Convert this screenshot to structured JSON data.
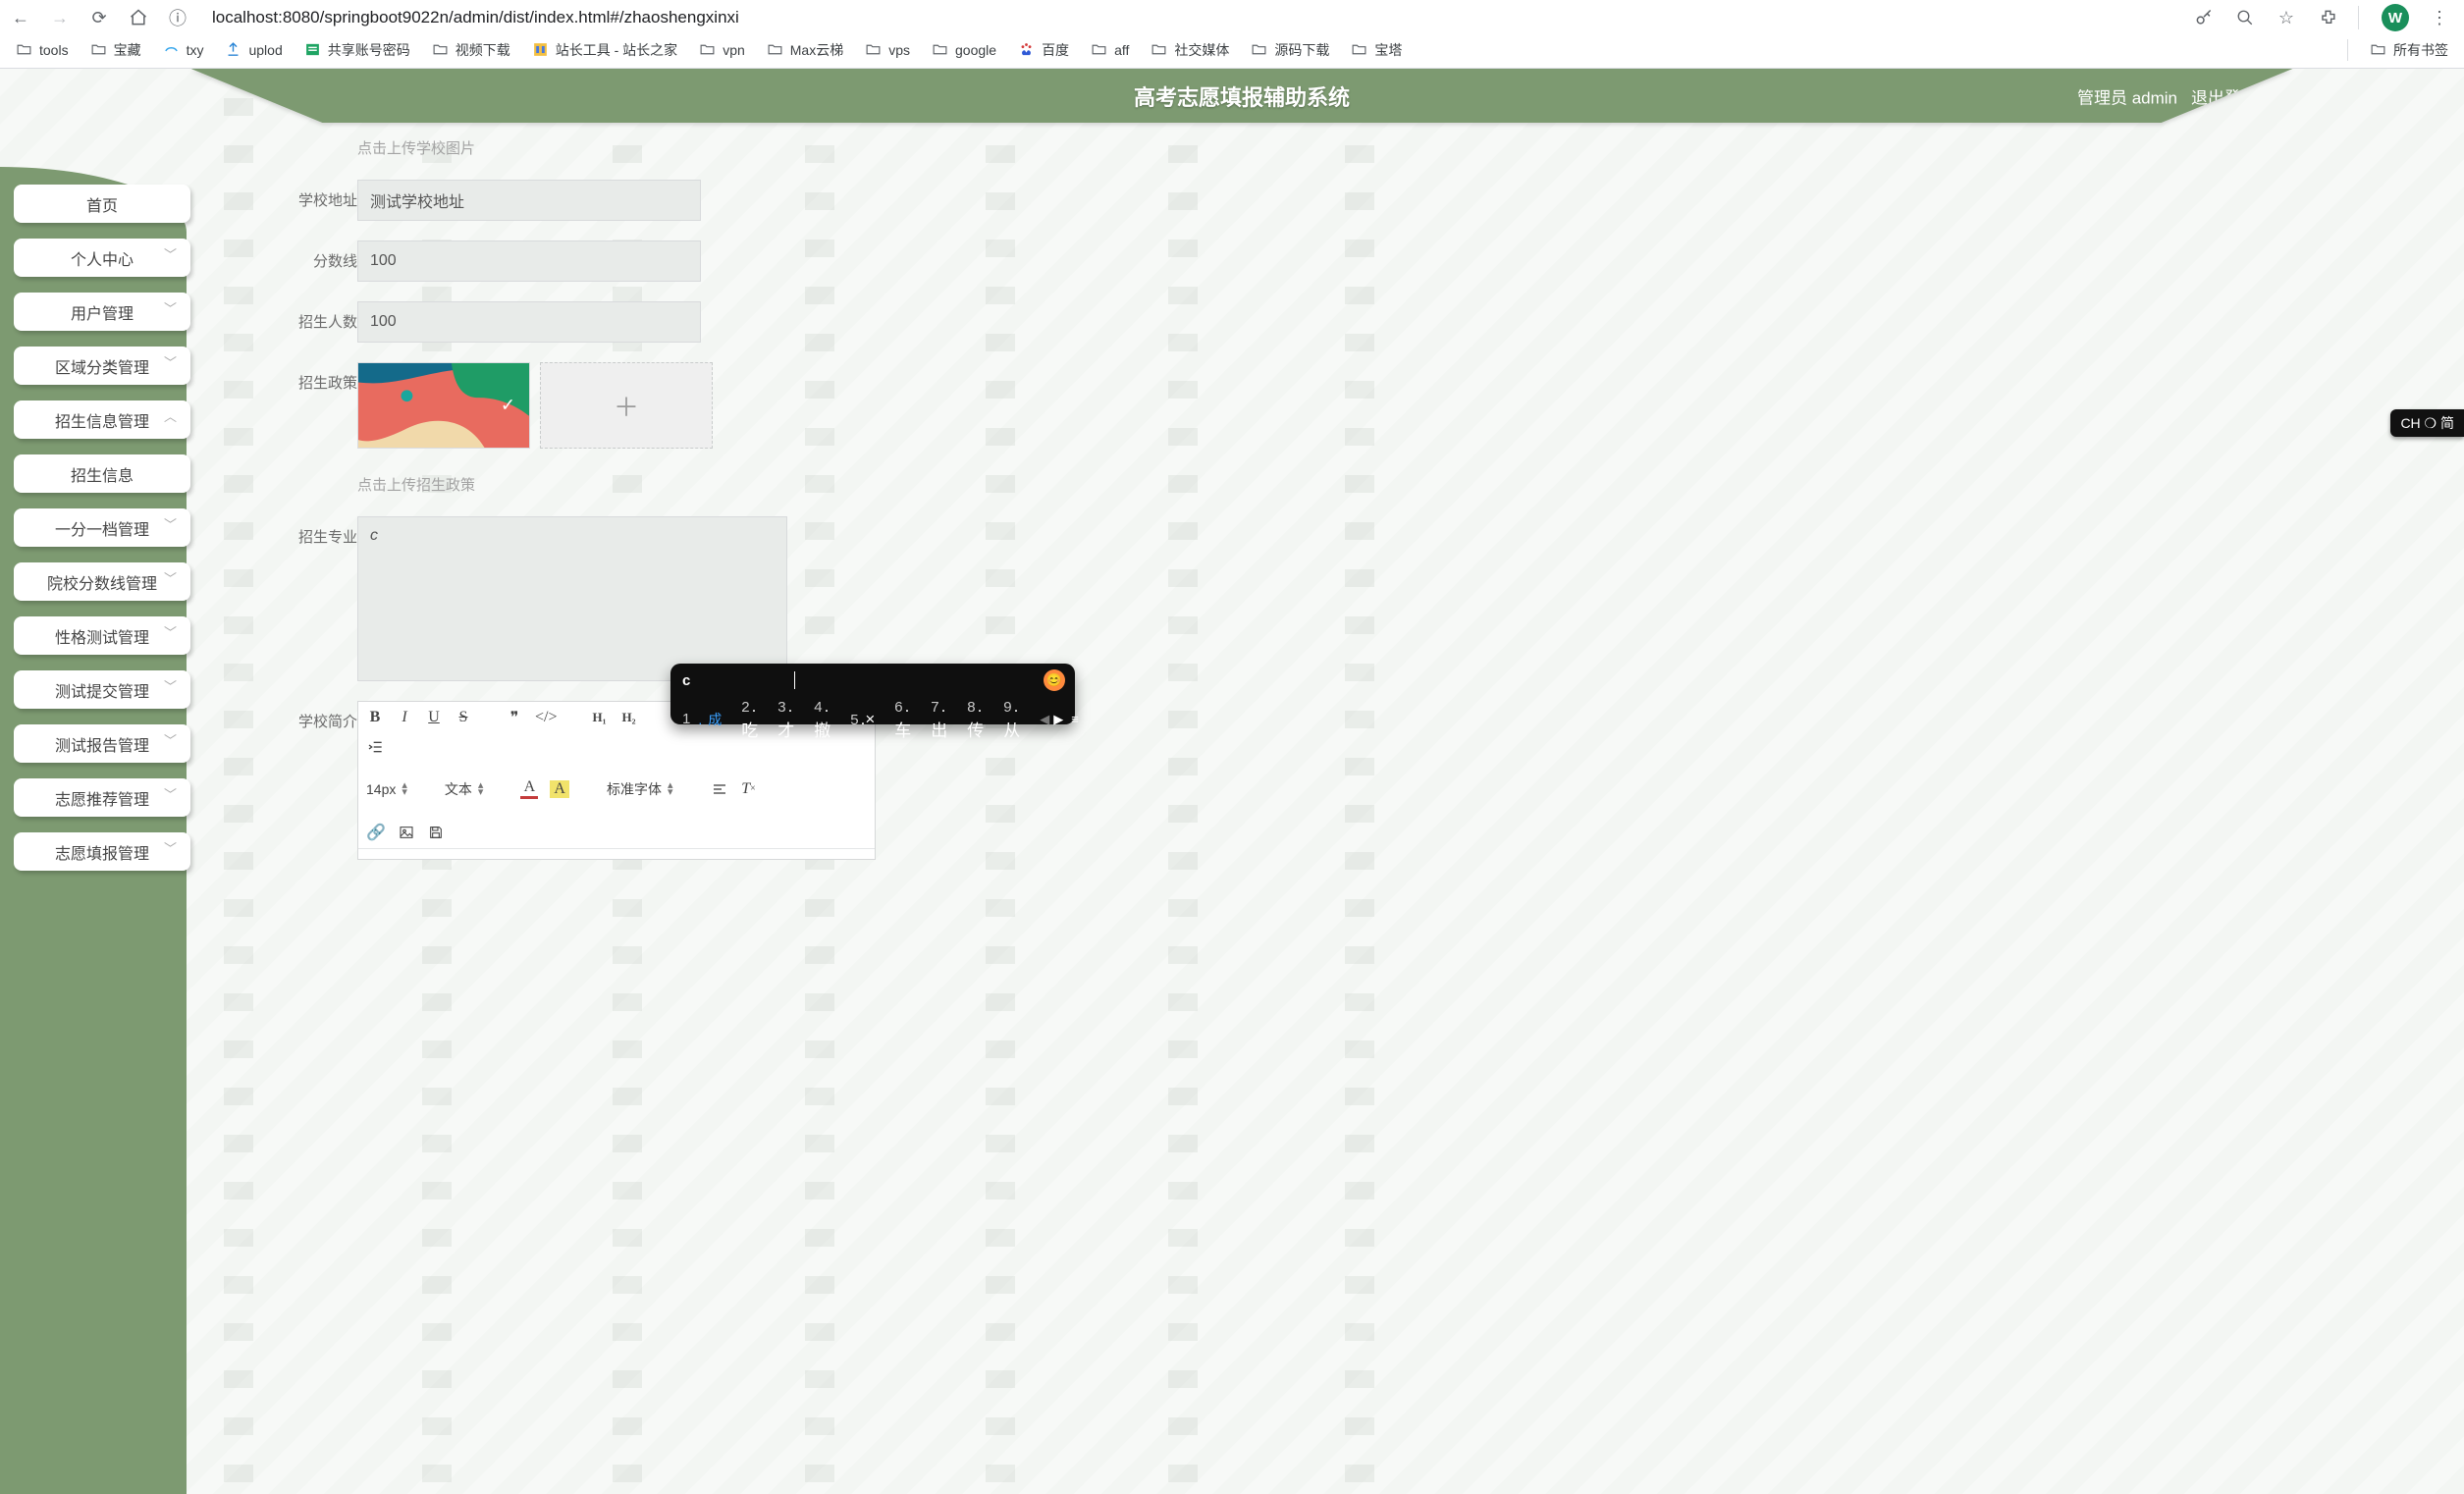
{
  "browser": {
    "url": "localhost:8080/springboot9022n/admin/dist/index.html#/zhaoshengxinxi",
    "avatar_letter": "W",
    "bookmarks": [
      "tools",
      "宝藏",
      "txy",
      "uplod",
      "共享账号密码",
      "视频下载",
      "站长工具 - 站长之家",
      "vpn",
      "Max云梯",
      "vps",
      "google",
      "百度",
      "aff",
      "社交媒体",
      "源码下载",
      "宝塔"
    ],
    "all_bookmarks": "所有书签"
  },
  "banner": {
    "title": "高考志愿填报辅助系统",
    "user_label": "管理员 admin",
    "logout": "退出登录"
  },
  "sidebar": {
    "items": [
      {
        "label": "首页",
        "expandable": false
      },
      {
        "label": "个人中心",
        "expandable": true
      },
      {
        "label": "用户管理",
        "expandable": true
      },
      {
        "label": "区域分类管理",
        "expandable": true
      },
      {
        "label": "招生信息管理",
        "expandable": true,
        "open": true
      },
      {
        "label": "招生信息",
        "expandable": false,
        "active": true
      },
      {
        "label": "一分一档管理",
        "expandable": true
      },
      {
        "label": "院校分数线管理",
        "expandable": true
      },
      {
        "label": "性格测试管理",
        "expandable": true
      },
      {
        "label": "测试提交管理",
        "expandable": true
      },
      {
        "label": "测试报告管理",
        "expandable": true
      },
      {
        "label": "志愿推荐管理",
        "expandable": true
      },
      {
        "label": "志愿填报管理",
        "expandable": true
      }
    ]
  },
  "form": {
    "upload_school_hint": "点击上传学校图片",
    "labels": {
      "address": "学校地址",
      "score": "分数线",
      "enroll": "招生人数",
      "policy": "招生政策",
      "policy_upload_hint": "点击上传招生政策",
      "major": "招生专业",
      "intro": "学校简介"
    },
    "values": {
      "address": "测试学校地址",
      "score": "100",
      "enroll": "100",
      "major": "c"
    },
    "editor": {
      "font_size": "14px",
      "text_type": "文本",
      "font_family": "标准字体"
    }
  },
  "ime": {
    "input": "c",
    "candidates": [
      {
        "n": "1",
        "w": "成",
        "sel": true
      },
      {
        "n": "2",
        "w": "吃"
      },
      {
        "n": "3",
        "w": "才"
      },
      {
        "n": "4",
        "w": "撤"
      },
      {
        "n": "5",
        "w": "×"
      },
      {
        "n": "6",
        "w": "车"
      },
      {
        "n": "7",
        "w": "出"
      },
      {
        "n": "8",
        "w": "传"
      },
      {
        "n": "9",
        "w": "从"
      }
    ],
    "pill": "CH ❍ 简"
  }
}
